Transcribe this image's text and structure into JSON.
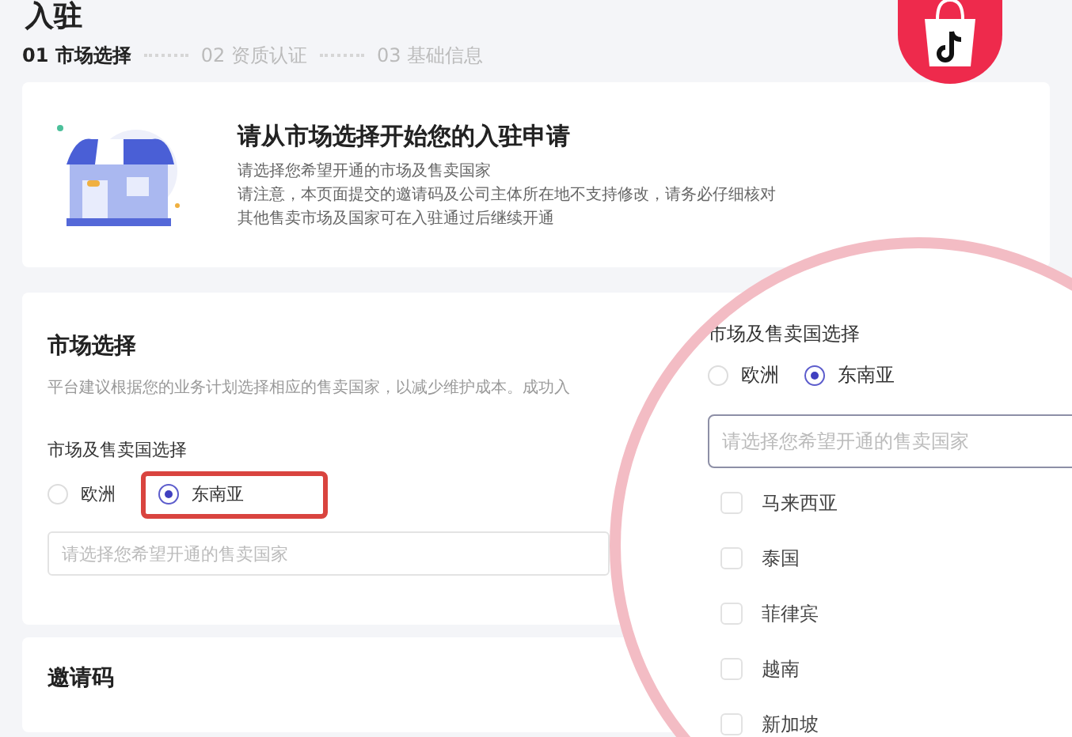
{
  "page_title": "入驻",
  "steps": [
    {
      "label": "01 市场选择",
      "selected": true
    },
    {
      "label": "02 资质认证",
      "selected": false
    },
    {
      "label": "03 基础信息",
      "selected": false
    }
  ],
  "intro": {
    "title": "请从市场选择开始您的入驻申请",
    "lines": [
      "请选择您希望开通的市场及售卖国家",
      "请注意，本页面提交的邀请码及公司主体所在地不支持修改，请务必仔细核对",
      "其他售卖市场及国家可在入驻通过后继续开通"
    ]
  },
  "market_card": {
    "title": "市场选择",
    "description": "平台建议根据您的业务计划选择相应的售卖国家，以减少维护成本。成功入",
    "field_label": "市场及售卖国选择",
    "radios": [
      {
        "label": "欧洲",
        "selected": false
      },
      {
        "label": "东南亚",
        "selected": true
      }
    ],
    "placeholder": "请选择您希望开通的售卖国家"
  },
  "magnifier": {
    "field_label": "市场及售卖国选择",
    "radios": [
      {
        "label": "欧洲",
        "selected": false
      },
      {
        "label": "东南亚",
        "selected": true
      }
    ],
    "placeholder": "请选择您希望开通的售卖国家",
    "options": [
      {
        "label": "马来西亚",
        "checked": false
      },
      {
        "label": "泰国",
        "checked": false
      },
      {
        "label": "菲律宾",
        "checked": false
      },
      {
        "label": "越南",
        "checked": false
      },
      {
        "label": "新加坡",
        "checked": false
      }
    ]
  },
  "invite_card": {
    "title": "邀请码"
  }
}
